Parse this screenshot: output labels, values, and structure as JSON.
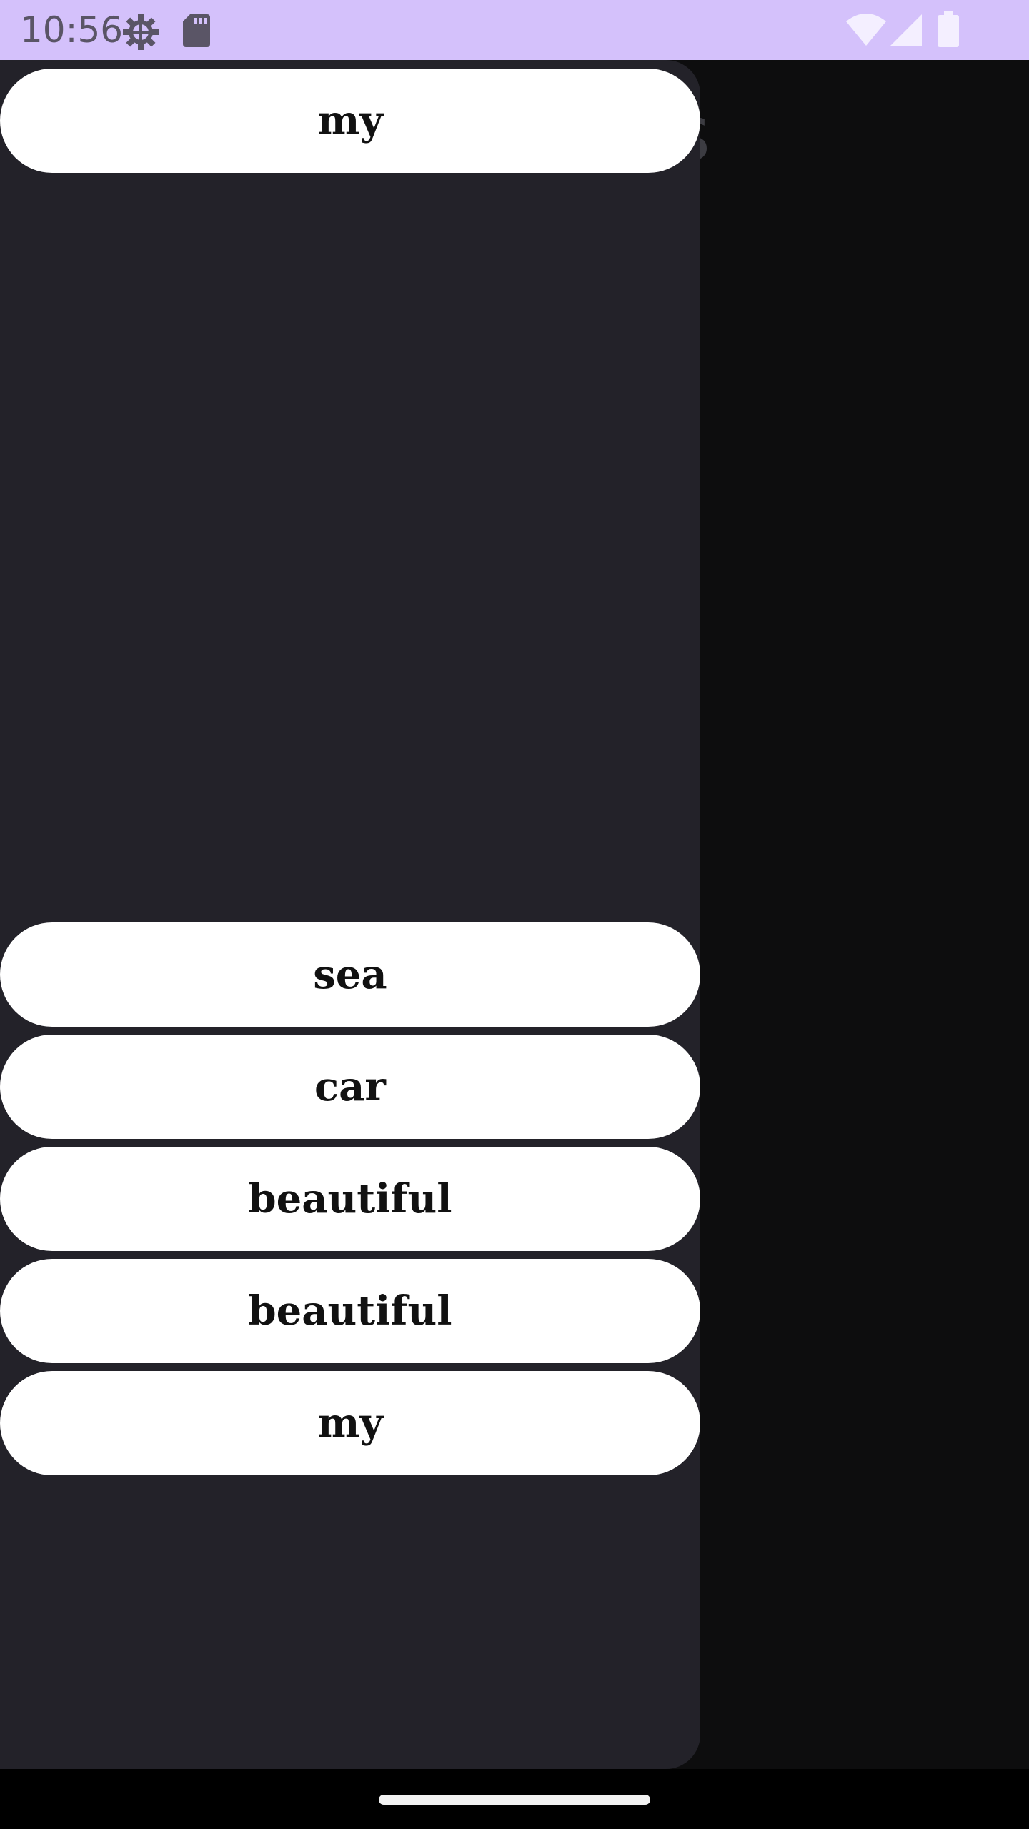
{
  "status_bar": {
    "time": "10:56",
    "icons": [
      "settings-gear-icon",
      "sd-card-icon",
      "wifi-icon",
      "cellular-signal-icon",
      "battery-icon"
    ],
    "background_color": "#d4c1fb"
  },
  "background": {
    "title_fragment": "s"
  },
  "drawer": {
    "background_color": "#232229",
    "items": [
      {
        "label": "my"
      },
      {
        "label": "sea"
      },
      {
        "label": "car"
      },
      {
        "label": "beautiful"
      },
      {
        "label": "beautiful"
      },
      {
        "label": "my"
      }
    ]
  }
}
